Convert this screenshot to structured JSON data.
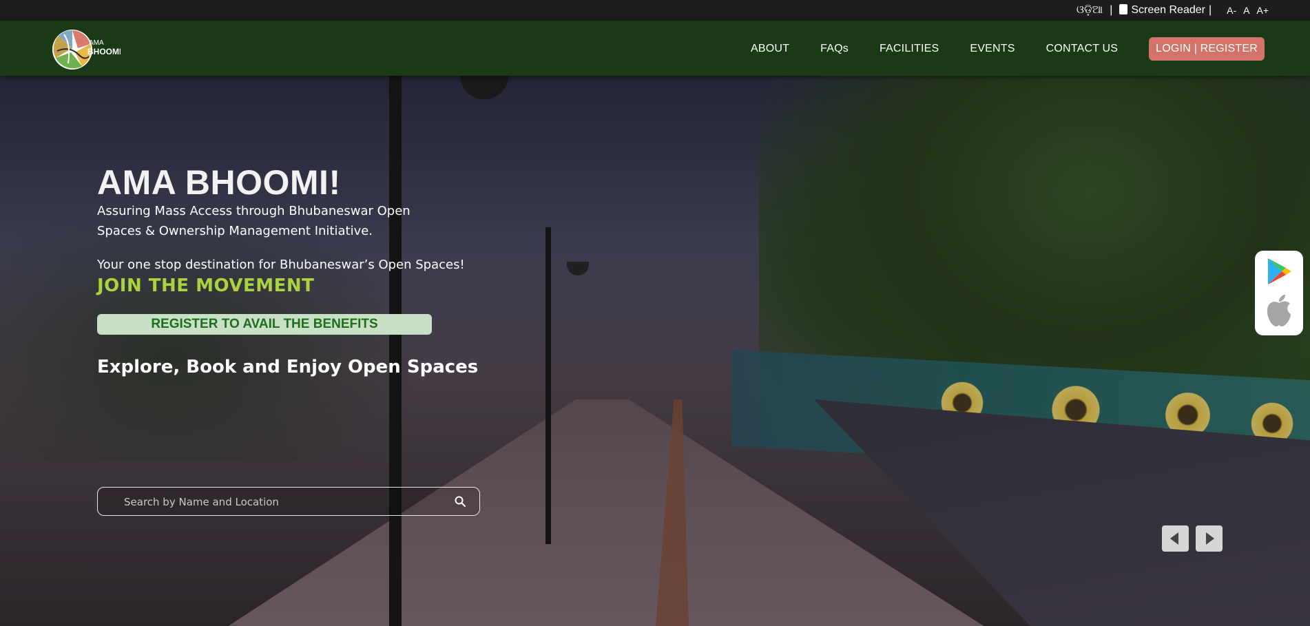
{
  "topbar": {
    "language": "ଓଡ଼ିଆ",
    "separator": "|",
    "screen_reader": "Screen Reader",
    "screen_reader_sep": "|",
    "font_decrease": "A-",
    "font_normal": "A",
    "font_increase": "A+"
  },
  "nav": {
    "logo_text_top": "AMA",
    "logo_text_bottom": "BHOOMI",
    "items": [
      "ABOUT",
      "FAQs",
      "FACILITIES",
      "EVENTS",
      "CONTACT US"
    ],
    "login": "LOGIN | REGISTER"
  },
  "hero": {
    "title": "AMA BHOOMI!",
    "subtitle": "Assuring Mass Access through Bhubaneswar Open Spaces & Ownership Management Initiative.",
    "tagline": "Your one stop destination for Bhubaneswar’s Open Spaces!",
    "movement": "JOIN THE MOVEMENT",
    "register": "REGISTER TO AVAIL THE BENEFITS",
    "explore": "Explore, Book and Enjoy Open Spaces",
    "search_placeholder": "Search by Name and Location"
  },
  "colors": {
    "topbar": "#1e1d1d",
    "navbar": "#1a3a16",
    "login_button": "#d4736a",
    "movement": "#aed13e",
    "register_bg": "#c8e0c6",
    "register_text": "#1f6e1b"
  },
  "icons": {
    "screen_reader": "tablet-icon",
    "search": "search-icon",
    "play_store": "google-play-icon",
    "app_store": "apple-icon",
    "prev": "chevron-left-icon",
    "next": "chevron-right-icon"
  }
}
